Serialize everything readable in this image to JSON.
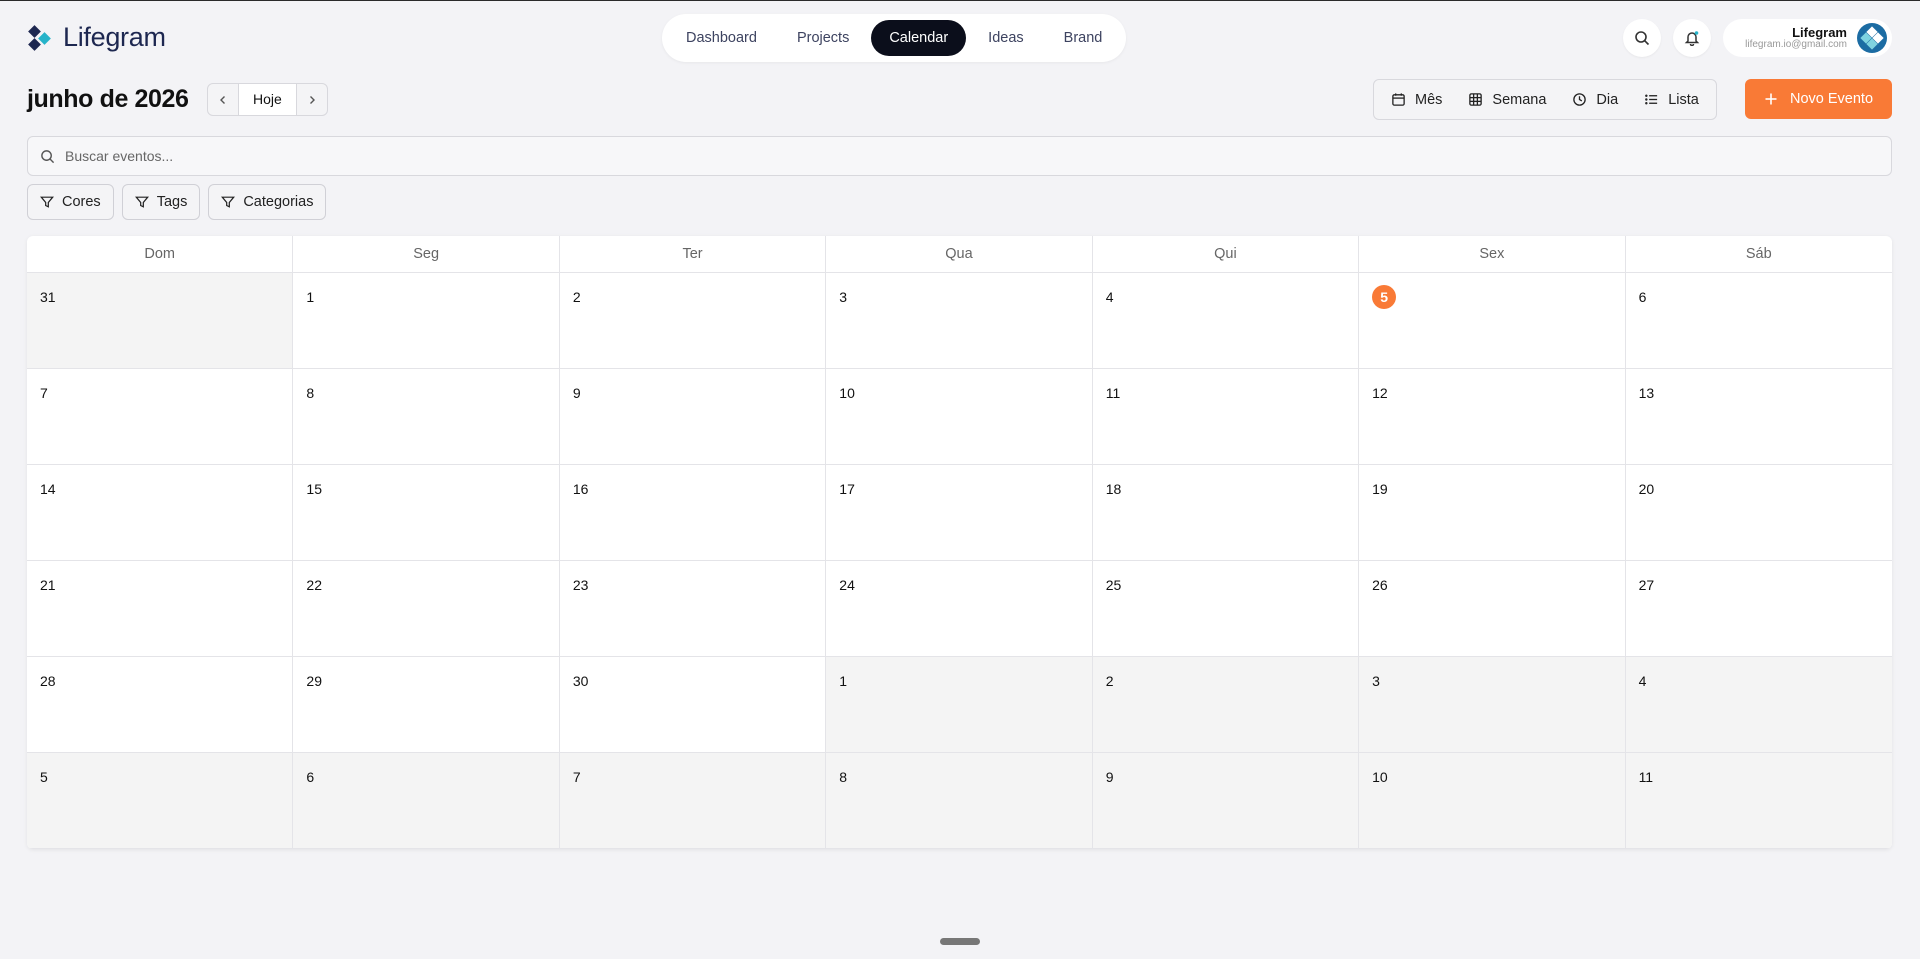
{
  "app": {
    "name": "Lifegram"
  },
  "nav": {
    "items": [
      {
        "label": "Dashboard",
        "active": false
      },
      {
        "label": "Projects",
        "active": false
      },
      {
        "label": "Calendar",
        "active": true
      },
      {
        "label": "Ideas",
        "active": false
      },
      {
        "label": "Brand",
        "active": false
      }
    ]
  },
  "profile": {
    "name": "Lifegram",
    "email": "lifegram.io@gmail.com"
  },
  "toolbar": {
    "title": "junho de 2026",
    "today_label": "Hoje",
    "views": [
      {
        "label": "Mês",
        "icon": "calendar-icon"
      },
      {
        "label": "Semana",
        "icon": "grid-icon"
      },
      {
        "label": "Dia",
        "icon": "clock-icon"
      },
      {
        "label": "Lista",
        "icon": "list-icon"
      }
    ],
    "new_event_label": "Novo Evento"
  },
  "search": {
    "placeholder": "Buscar eventos...",
    "value": ""
  },
  "filters": [
    {
      "label": "Cores"
    },
    {
      "label": "Tags"
    },
    {
      "label": "Categorias"
    }
  ],
  "calendar": {
    "weekdays": [
      "Dom",
      "Seg",
      "Ter",
      "Qua",
      "Qui",
      "Sex",
      "Sáb"
    ],
    "today": 5,
    "weeks": [
      [
        {
          "d": "31",
          "out": true
        },
        {
          "d": "1"
        },
        {
          "d": "2"
        },
        {
          "d": "3"
        },
        {
          "d": "4"
        },
        {
          "d": "5",
          "today": true
        },
        {
          "d": "6"
        }
      ],
      [
        {
          "d": "7"
        },
        {
          "d": "8"
        },
        {
          "d": "9"
        },
        {
          "d": "10"
        },
        {
          "d": "11"
        },
        {
          "d": "12"
        },
        {
          "d": "13"
        }
      ],
      [
        {
          "d": "14"
        },
        {
          "d": "15"
        },
        {
          "d": "16"
        },
        {
          "d": "17"
        },
        {
          "d": "18"
        },
        {
          "d": "19"
        },
        {
          "d": "20"
        }
      ],
      [
        {
          "d": "21"
        },
        {
          "d": "22"
        },
        {
          "d": "23"
        },
        {
          "d": "24"
        },
        {
          "d": "25"
        },
        {
          "d": "26"
        },
        {
          "d": "27"
        }
      ],
      [
        {
          "d": "28"
        },
        {
          "d": "29"
        },
        {
          "d": "30"
        },
        {
          "d": "1",
          "out": true
        },
        {
          "d": "2",
          "out": true
        },
        {
          "d": "3",
          "out": true
        },
        {
          "d": "4",
          "out": true
        }
      ],
      [
        {
          "d": "5",
          "out": true
        },
        {
          "d": "6",
          "out": true
        },
        {
          "d": "7",
          "out": true
        },
        {
          "d": "8",
          "out": true
        },
        {
          "d": "9",
          "out": true
        },
        {
          "d": "10",
          "out": true
        },
        {
          "d": "11",
          "out": true
        }
      ]
    ]
  },
  "colors": {
    "accent": "#f97a36",
    "nav_active": "#0b0e1b",
    "brand": "#1d2750"
  }
}
